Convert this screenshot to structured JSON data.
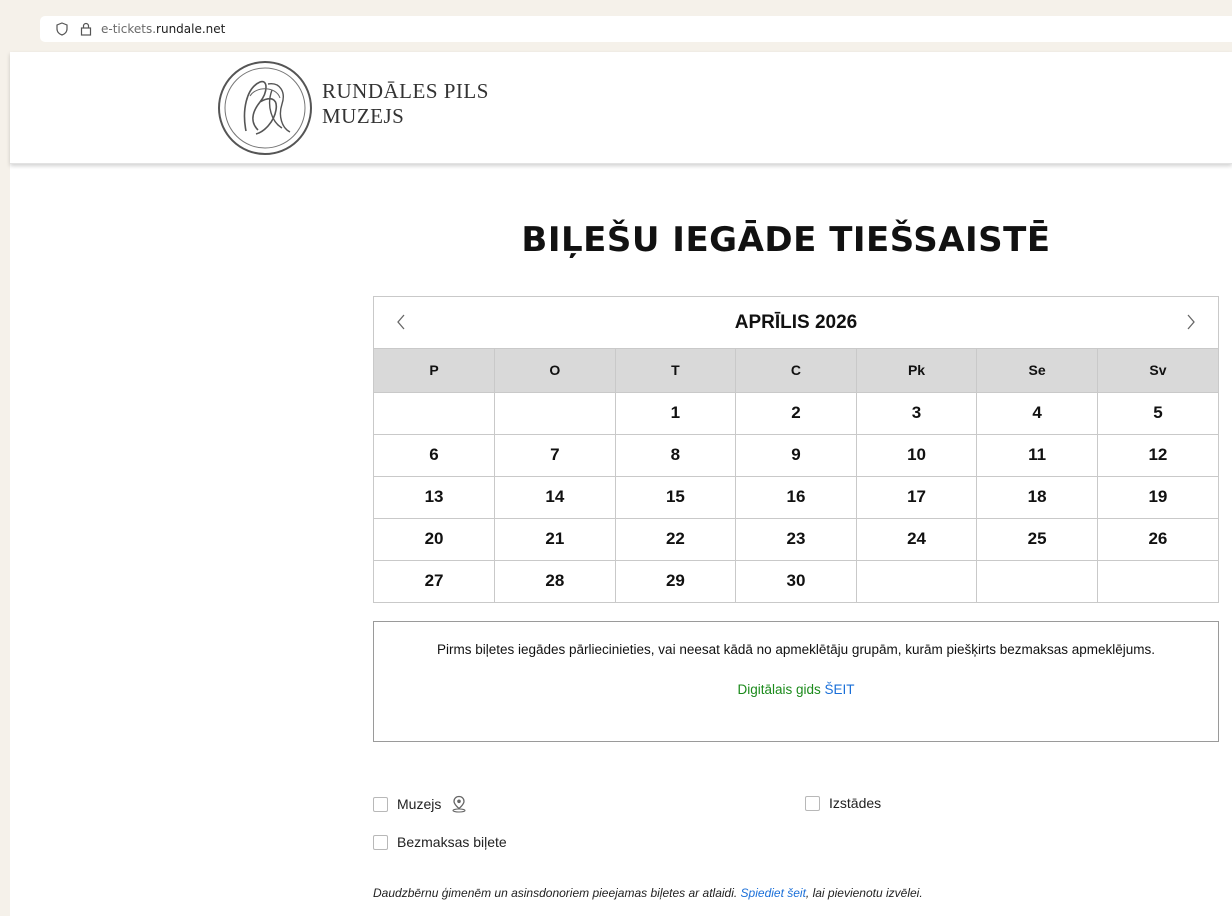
{
  "browser": {
    "url_prefix": "e-tickets.",
    "url_domain": "rundale.net"
  },
  "header": {
    "brand_line1": "RUNDĀLES PILS",
    "brand_line2": "MUZEJS"
  },
  "page_title": "BIĻEŠU IEGĀDE TIEŠSAISTĒ",
  "calendar": {
    "month_label": "APRĪLIS 2026",
    "weekdays": [
      "P",
      "O",
      "T",
      "C",
      "Pk",
      "Se",
      "Sv"
    ],
    "weeks": [
      [
        "",
        "",
        "1",
        "2",
        "3",
        "4",
        "5"
      ],
      [
        "6",
        "7",
        "8",
        "9",
        "10",
        "11",
        "12"
      ],
      [
        "13",
        "14",
        "15",
        "16",
        "17",
        "18",
        "19"
      ],
      [
        "20",
        "21",
        "22",
        "23",
        "24",
        "25",
        "26"
      ],
      [
        "27",
        "28",
        "29",
        "30",
        "",
        "",
        ""
      ]
    ]
  },
  "notice": {
    "text": "Pirms biļetes iegādes pārliecinieties, vai neesat kādā no apmeklētāju grupām, kurām piešķirts bezmaksas apmeklējums.",
    "guide_label": "Digitālais gids",
    "here_label": "ŠEIT"
  },
  "options": {
    "museum_label": "Muzejs",
    "exhibitions_label": "Izstādes",
    "free_ticket_label": "Bezmaksas biļete"
  },
  "footnote": {
    "text_before": "Daudzbērnu ģimenēm un asinsdonoriem pieejamas biļetes ar atlaidi. ",
    "link_label": "Spiediet šeit",
    "text_after": ", lai pievienotu izvēlei."
  },
  "colors": {
    "guide_green": "#1b8a1b",
    "link_blue": "#1a6fd8",
    "weekday_header_bg": "#d9d9d9"
  }
}
